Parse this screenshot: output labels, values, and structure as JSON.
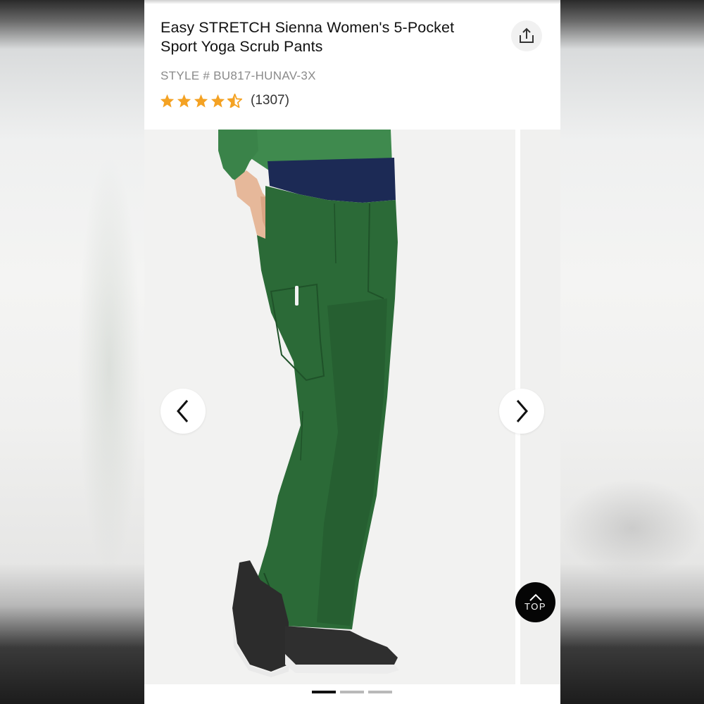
{
  "product": {
    "title": "Easy STRETCH Sienna Women's 5-Pocket Sport Yoga Scrub Pants",
    "style": "STYLE # BU817-HUNAV-3X",
    "rating": 4.5,
    "review_count": "(1307)"
  },
  "gallery": {
    "slide_count": 3,
    "active_slide": 1
  },
  "top_button": {
    "label": "TOP"
  },
  "icons": {
    "share": "share-icon",
    "prev": "chevron-left-icon",
    "next": "chevron-right-icon",
    "up": "chevron-up-icon",
    "star": "star-icon"
  },
  "colors": {
    "star": "#f4a223",
    "pants": "#2b6a37",
    "waistband": "#1c2a55"
  }
}
